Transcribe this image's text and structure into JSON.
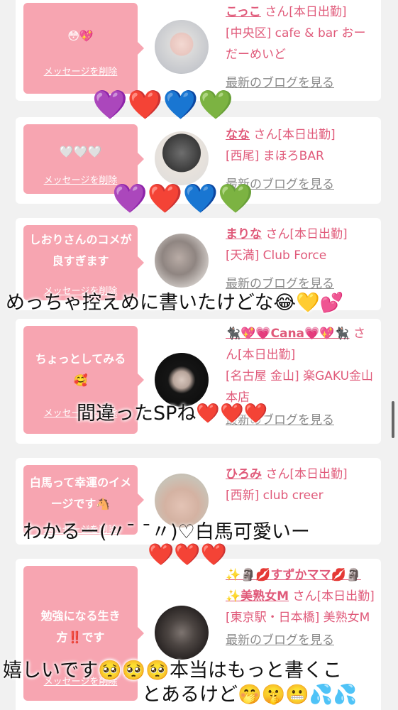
{
  "cards": [
    {
      "message": "😳💖",
      "delete_label": "メッセージを削除",
      "name": "こっこ",
      "san": "さん[本日出勤]",
      "area": "[中央区] cafe & bar おーだーめいど",
      "blog": "最新のブログを見る"
    },
    {
      "message": "🤍🤍🤍",
      "delete_label": "メッセージを削除",
      "name": "なな",
      "san": "さん[本日出勤]",
      "area": "[西尾] まほろBAR",
      "blog": "最新のブログを見る"
    },
    {
      "message": "しおりさんのコメが良すぎます",
      "delete_label": "メッセージを削除",
      "name": "まりな",
      "san": "さん[本日出勤]",
      "area": "[天満] Club Force",
      "blog": "最新のブログを見る"
    },
    {
      "message": "ちょっとしてみる🥰",
      "delete_label": "メッセージを削除",
      "name": "🐈‍⬛💖💗Cana💗💖🐈‍⬛",
      "san": "さん[本日出勤]",
      "area": "[名古屋 金山] 楽GAKU金山本店",
      "blog": "最新のブログを見る"
    },
    {
      "message": "白馬って幸運のイメージです🐴",
      "delete_label": "メッセージを削除",
      "name": "ひろみ",
      "san": "さん[本日出勤]",
      "area": "[西新] club creer",
      "blog": "最新のブログを見る"
    },
    {
      "message": "勉強になる生き方‼️です",
      "delete_label": "メッセージを削除",
      "name": "✨🗿💋すずかママ💋🗿✨美熟女M",
      "san": "さん[本日出勤]",
      "area": "[東京駅・日本橋] 美熟女M",
      "blog": "最新のブログを見る"
    }
  ],
  "overlays": {
    "hearts_1": "💜❤️💙💚",
    "hearts_2": "💜❤️💙💚",
    "text_1": "めっちゃ控えめに書いたけどな😂💛💕",
    "text_2": "間違ったSPね❤️❤️❤️",
    "text_3": "わかるー(〃¯ ¯〃)♡白馬可愛いー",
    "hearts_3": "❤️❤️❤️",
    "text_4a": "嬉しいです🥺🥺🥺本当はもっと書くこ",
    "text_4b": "とあるけど🤭🤫😬💦💦"
  }
}
